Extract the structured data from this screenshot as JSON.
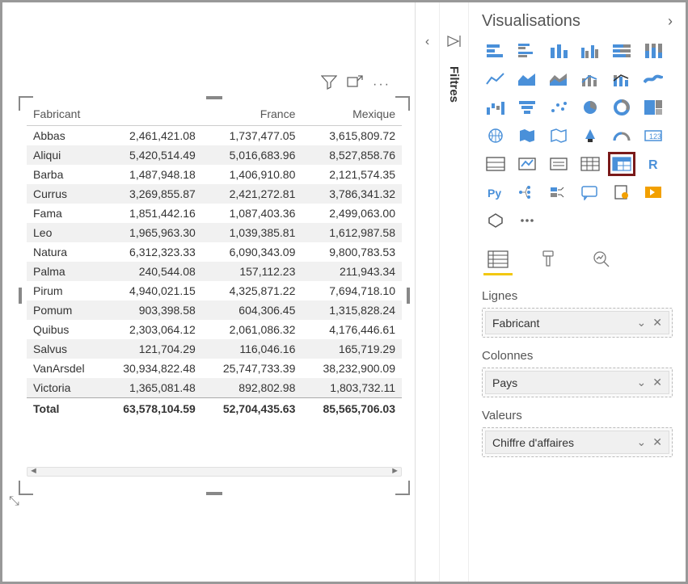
{
  "viz_panel": {
    "title": "Visualisations"
  },
  "filters_panel": {
    "title": "Filtres"
  },
  "matrix": {
    "row_header": "Fabricant",
    "columns": [
      "France",
      "Mexique"
    ],
    "rows": [
      {
        "label": "Abbas",
        "v": [
          "2,461,421.08",
          "1,737,477.05",
          "3,615,809.72"
        ]
      },
      {
        "label": "Aliqui",
        "v": [
          "5,420,514.49",
          "5,016,683.96",
          "8,527,858.76"
        ]
      },
      {
        "label": "Barba",
        "v": [
          "1,487,948.18",
          "1,406,910.80",
          "2,121,574.35"
        ]
      },
      {
        "label": "Currus",
        "v": [
          "3,269,855.87",
          "2,421,272.81",
          "3,786,341.32"
        ]
      },
      {
        "label": "Fama",
        "v": [
          "1,851,442.16",
          "1,087,403.36",
          "2,499,063.00"
        ]
      },
      {
        "label": "Leo",
        "v": [
          "1,965,963.30",
          "1,039,385.81",
          "1,612,987.58"
        ]
      },
      {
        "label": "Natura",
        "v": [
          "6,312,323.33",
          "6,090,343.09",
          "9,800,783.53"
        ]
      },
      {
        "label": "Palma",
        "v": [
          "240,544.08",
          "157,112.23",
          "211,943.34"
        ]
      },
      {
        "label": "Pirum",
        "v": [
          "4,940,021.15",
          "4,325,871.22",
          "7,694,718.10"
        ]
      },
      {
        "label": "Pomum",
        "v": [
          "903,398.58",
          "604,306.45",
          "1,315,828.24"
        ]
      },
      {
        "label": "Quibus",
        "v": [
          "2,303,064.12",
          "2,061,086.32",
          "4,176,446.61"
        ]
      },
      {
        "label": "Salvus",
        "v": [
          "121,704.29",
          "116,046.16",
          "165,719.29"
        ]
      },
      {
        "label": "VanArsdel",
        "v": [
          "30,934,822.48",
          "25,747,733.39",
          "38,232,900.09"
        ]
      },
      {
        "label": "Victoria",
        "v": [
          "1,365,081.48",
          "892,802.98",
          "1,803,732.11"
        ]
      }
    ],
    "total_label": "Total",
    "totals": [
      "63,578,104.59",
      "52,704,435.63",
      "85,565,706.03"
    ]
  },
  "fields": {
    "rows_label": "Lignes",
    "rows_value": "Fabricant",
    "cols_label": "Colonnes",
    "cols_value": "Pays",
    "vals_label": "Valeurs",
    "vals_value": "Chiffre d'affaires"
  },
  "viz_icons": [
    "stacked-bar",
    "clustered-bar",
    "stacked-column",
    "clustered-column",
    "stacked-bar-100",
    "stacked-column-100",
    "line",
    "area",
    "stacked-area",
    "line-column",
    "line-column-stacked",
    "ribbon",
    "waterfall",
    "funnel",
    "scatter",
    "pie",
    "donut",
    "treemap",
    "map",
    "filled-map",
    "shape-map",
    "azure-map",
    "gauge",
    "card",
    "multi-card",
    "kpi",
    "slicer",
    "table",
    "matrix",
    "r-visual",
    "python-visual",
    "decomposition",
    "key-influencers",
    "qna",
    "paginated",
    "power-automate",
    "store",
    "more"
  ],
  "selected_viz": "matrix",
  "chart_data": {
    "type": "table",
    "title": "Chiffre d'affaires par Fabricant et Pays",
    "row_dimension": "Fabricant",
    "column_dimension": "Pays",
    "measure": "Chiffre d'affaires",
    "columns_visible": [
      "France",
      "Mexique"
    ],
    "series": [
      {
        "name": "Abbas",
        "France": 2461421.08,
        "Mexique": 3615809.72
      },
      {
        "name": "Aliqui",
        "France": 5420514.49,
        "Mexique": 8527858.76
      },
      {
        "name": "Barba",
        "France": 1487948.18,
        "Mexique": 2121574.35
      },
      {
        "name": "Currus",
        "France": 3269855.87,
        "Mexique": 3786341.32
      },
      {
        "name": "Fama",
        "France": 1851442.16,
        "Mexique": 2499063.0
      },
      {
        "name": "Leo",
        "France": 1965963.3,
        "Mexique": 1612987.58
      },
      {
        "name": "Natura",
        "France": 6312323.33,
        "Mexique": 9800783.53
      },
      {
        "name": "Palma",
        "France": 240544.08,
        "Mexique": 211943.34
      },
      {
        "name": "Pirum",
        "France": 4940021.15,
        "Mexique": 7694718.1
      },
      {
        "name": "Pomum",
        "France": 903398.58,
        "Mexique": 1315828.24
      },
      {
        "name": "Quibus",
        "France": 2303064.12,
        "Mexique": 4176446.61
      },
      {
        "name": "Salvus",
        "France": 121704.29,
        "Mexique": 165719.29
      },
      {
        "name": "VanArsdel",
        "France": 30934822.48,
        "Mexique": 38232900.09
      },
      {
        "name": "Victoria",
        "France": 1365081.48,
        "Mexique": 1803732.11
      }
    ],
    "totals": {
      "France": 63578104.59,
      "Mexique": 85565706.03
    }
  }
}
